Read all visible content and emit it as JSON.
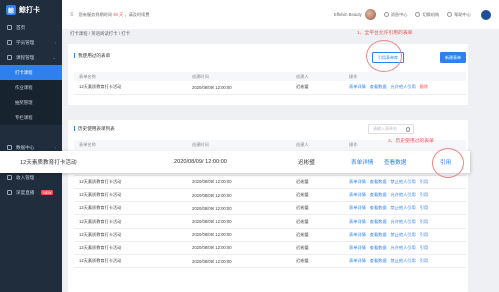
{
  "app": {
    "name": "鲸打卡",
    "logo_glyph": "鲸"
  },
  "sidebar": {
    "items": [
      {
        "label": "首页",
        "icon": "home-icon"
      },
      {
        "label": "学员管理",
        "icon": "user-icon",
        "arrow": "›"
      },
      {
        "label": "课程管理",
        "icon": "book-icon",
        "arrow": "›"
      }
    ],
    "sub_items": [
      "打卡课程",
      "作业课程",
      "抽奖管理",
      "专栏课程"
    ],
    "items_bottom": [
      {
        "label": "数据中心",
        "icon": "chart-icon",
        "arrow": "›"
      },
      {
        "label": "积分商城",
        "icon": "gift-icon",
        "arrow": "›"
      },
      {
        "label": "收入管理",
        "icon": "wallet-icon"
      },
      {
        "label": "深度直播",
        "icon": "live-icon",
        "badge": "NEW"
      }
    ]
  },
  "topbar": {
    "menu_glyph": "≡",
    "notice_prefix": "您有服务到期时间",
    "notice_days": "98 天",
    "notice_suffix": "，请及时续费",
    "user_name": "Effelvin Beauty",
    "links": [
      "消息中心",
      "切换机构",
      "帮助中心"
    ]
  },
  "breadcrumb": "打卡课程 / 英语阅读打卡 / 打卡",
  "section1": {
    "title": "我使用过的表单",
    "btn_outline": "引用表单库",
    "btn_primary": "新建表单",
    "columns": [
      "表单名称",
      "创建时间",
      "创建人",
      "操作"
    ],
    "rows": [
      {
        "name": "12天素质教育打卡活动",
        "time": "2020/08/09/ 12:00:00",
        "creator": "迟彬璧",
        "ops": [
          "表单详情",
          "查看数据",
          "允许他人引用"
        ],
        "op_red": "删除"
      }
    ]
  },
  "section2": {
    "title": "历史使用表单列表",
    "search_placeholder": "请输入表单名",
    "columns": [
      "表单名称",
      "创建时间",
      "创建人",
      "操作"
    ],
    "rows": [
      {
        "name": "12天素质教育打卡活动",
        "time": "2020/08/09/ 12:00:00",
        "creator": "迟彬璧",
        "ops": [
          "表单详情",
          "查看数据",
          "禁止他人引用",
          "引用"
        ]
      },
      {
        "name": "12天素质教育打卡活动",
        "time": "2020/08/09/ 12:00:00",
        "creator": "迟彬璧",
        "ops": [
          "表单详情",
          "查看数据",
          "允许他人引用",
          "引用"
        ]
      },
      {
        "name": "12天素质教育打卡活动",
        "time": "2020/08/09/ 12:00:00",
        "creator": "迟彬璧",
        "ops": [
          "表单详情",
          "查看数据",
          "禁止他人引用",
          "引用"
        ]
      },
      {
        "name": "12天素质教育打卡活动",
        "time": "2020/08/09/ 12:00:00",
        "creator": "迟彬璧",
        "ops": [
          "表单详情",
          "查看数据",
          "允许他人引用",
          "引用"
        ]
      },
      {
        "name": "12天素质教育打卡活动",
        "time": "2020/08/09/ 12:00:00",
        "creator": "迟彬璧",
        "ops": [
          "表单详情",
          "查看数据",
          "禁止他人引用",
          "引用"
        ]
      },
      {
        "name": "12天素质教育打卡活动",
        "time": "2020/08/09/ 12:00:00",
        "creator": "迟彬璧",
        "ops": [
          "表单详情",
          "查看数据",
          "允许他人引用",
          "引用"
        ]
      },
      {
        "name": "12天素质教育打卡活动",
        "time": "2020/08/09/ 12:00:00",
        "creator": "迟彬璧",
        "ops": [
          "表单详情",
          "查看数据",
          "禁止他人引用",
          "引用"
        ]
      },
      {
        "name": "12天素质教育打卡活动",
        "time": "2020/08/09/ 12:00:00",
        "creator": "迟彬璧",
        "ops": [
          "表单详情",
          "查看数据",
          "允许他人引用",
          "引用"
        ]
      },
      {
        "name": "12天素质教育打卡活动",
        "time": "2020/08/09/ 12:00:00",
        "creator": "迟彬璧",
        "ops": [
          "表单详情",
          "查看数据",
          "禁止他人引用",
          "引用"
        ]
      }
    ]
  },
  "zoom_row": {
    "name": "12天素质教育打卡活动",
    "time": "2020/08/09/ 12:00:00",
    "creator": "迟彬璧",
    "op1": "表单详情",
    "op2": "查看数据",
    "op3": "引用"
  },
  "annotations": [
    "1、全平台允许引用的表单",
    "2、历史使用过的表单"
  ],
  "colors": {
    "primary": "#2f80ed",
    "sidebar": "#1f2d3d",
    "annotation": "#e05a5a"
  }
}
